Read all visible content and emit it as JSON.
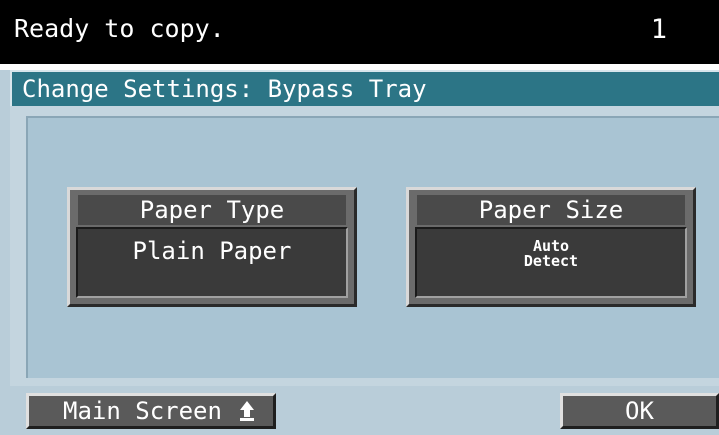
{
  "status_bar": {
    "message": "Ready to copy.",
    "copy_count": "1"
  },
  "title_bar": {
    "title": "Change Settings: Bypass Tray"
  },
  "settings": {
    "paper_type": {
      "label": "Paper Type",
      "value": "Plain Paper"
    },
    "paper_size": {
      "label": "Paper Size",
      "value": "Auto\nDetect"
    }
  },
  "bottom_bar": {
    "main_screen_label": "Main Screen",
    "main_screen_icon": "return-arrow-icon",
    "ok_label": "OK"
  },
  "colors": {
    "status_bar_bg": "#000000",
    "title_bar_bg": "#2c7586",
    "panel_bg": "#a9c4d3",
    "button_bg": "#6b6b6b"
  }
}
